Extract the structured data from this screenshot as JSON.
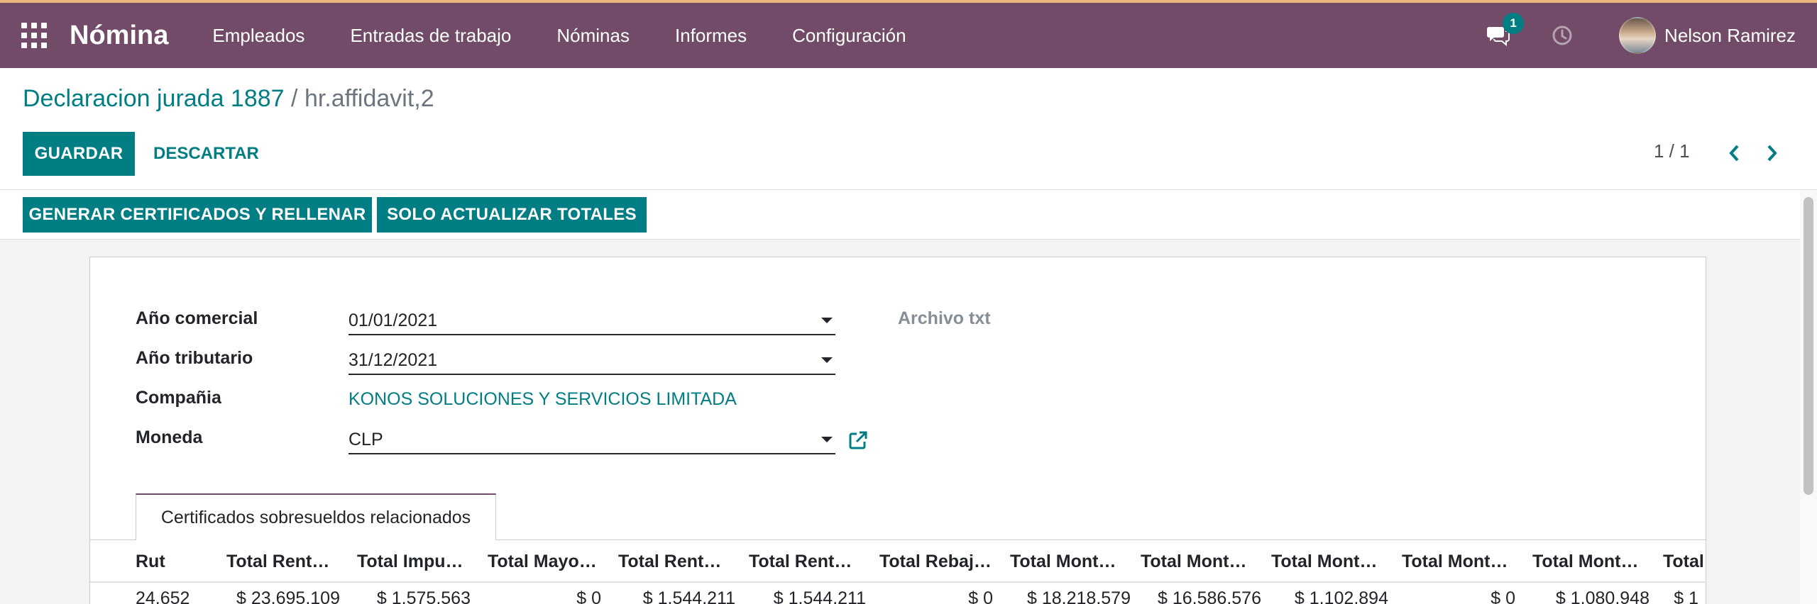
{
  "navbar": {
    "app_name": "Nómina",
    "menu": [
      "Empleados",
      "Entradas de trabajo",
      "Nóminas",
      "Informes",
      "Configuración"
    ],
    "messages_badge": "1",
    "user_name": "Nelson Ramirez",
    "icons": [
      "apps-grid-icon",
      "chat-icon",
      "clock-icon"
    ]
  },
  "breadcrumb": {
    "parent": "Declaracion jurada 1887",
    "separator": "/",
    "current": "hr.affidavit,2"
  },
  "buttons": {
    "save": "GUARDAR",
    "discard": "DESCARTAR",
    "generate": "GENERAR CERTIFICADOS Y RELLENAR",
    "update_totals": "SOLO ACTUALIZAR TOTALES"
  },
  "pager": {
    "text": "1 / 1"
  },
  "form": {
    "fiscal_year_label": "Año comercial",
    "fiscal_year_value": "01/01/2021",
    "tax_year_label": "Año tributario",
    "tax_year_value": "31/12/2021",
    "company_label": "Compañia",
    "company_value": "KONOS SOLUCIONES Y SERVICIOS LIMITADA",
    "currency_label": "Moneda",
    "currency_value": "CLP",
    "file_label": "Archivo txt"
  },
  "tabs": [
    {
      "label": "Certificados sobresueldos relacionados",
      "active": true
    }
  ],
  "table": {
    "headers": [
      "Rut",
      "Total Rent…",
      "Total Impu…",
      "Total Mayo…",
      "Total Rent…",
      "Total Rent…",
      "Total Rebaj…",
      "Total Mont…",
      "Total Mont…",
      "Total Mont…",
      "Total Mont…",
      "Total Mont…",
      "Total"
    ],
    "rows": [
      [
        "24.652",
        "$ 23.695.109",
        "$ 1.575.563",
        "$ 0",
        "$ 1.544.211",
        "$ 1.544.211",
        "$ 0",
        "$ 18.218.579",
        "$ 16.586.576",
        "$ 1.102.894",
        "$ 0",
        "$ 1.080.948",
        "$ 1"
      ]
    ]
  },
  "colors": {
    "navbar": "#714b67",
    "primary": "#017e84",
    "accent_top": "#e7b77e"
  }
}
